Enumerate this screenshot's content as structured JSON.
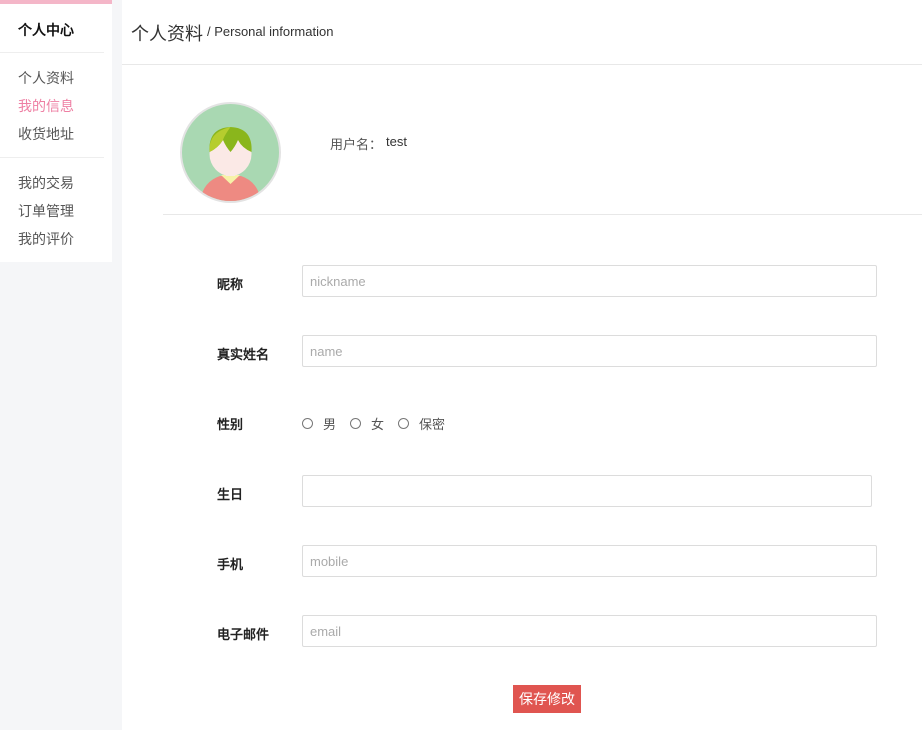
{
  "sidebar": {
    "title": "个人中心",
    "group1": [
      {
        "label": "个人资料",
        "active": false
      },
      {
        "label": "我的信息",
        "active": true
      },
      {
        "label": "收货地址",
        "active": false
      }
    ],
    "group2": [
      {
        "label": "我的交易"
      },
      {
        "label": "订单管理"
      },
      {
        "label": "我的评价"
      }
    ]
  },
  "header": {
    "title": "个人资料",
    "subtitle": "/ Personal information"
  },
  "profile": {
    "username_label": "用户名：",
    "username": "test"
  },
  "form": {
    "nickname": {
      "label": "昵称",
      "placeholder": "nickname",
      "value": ""
    },
    "realname": {
      "label": "真实姓名",
      "placeholder": "name",
      "value": ""
    },
    "gender": {
      "label": "性别",
      "options": [
        "男",
        "女",
        "保密"
      ]
    },
    "birthday": {
      "label": "生日",
      "value": ""
    },
    "mobile": {
      "label": "手机",
      "placeholder": "mobile",
      "value": ""
    },
    "email": {
      "label": "电子邮件",
      "placeholder": "email",
      "value": ""
    },
    "save_label": "保存修改"
  },
  "colors": {
    "accent_pink": "#ee7fa3",
    "sidebar_top_bar": "#f4b6c8",
    "save_button": "#e05550"
  }
}
